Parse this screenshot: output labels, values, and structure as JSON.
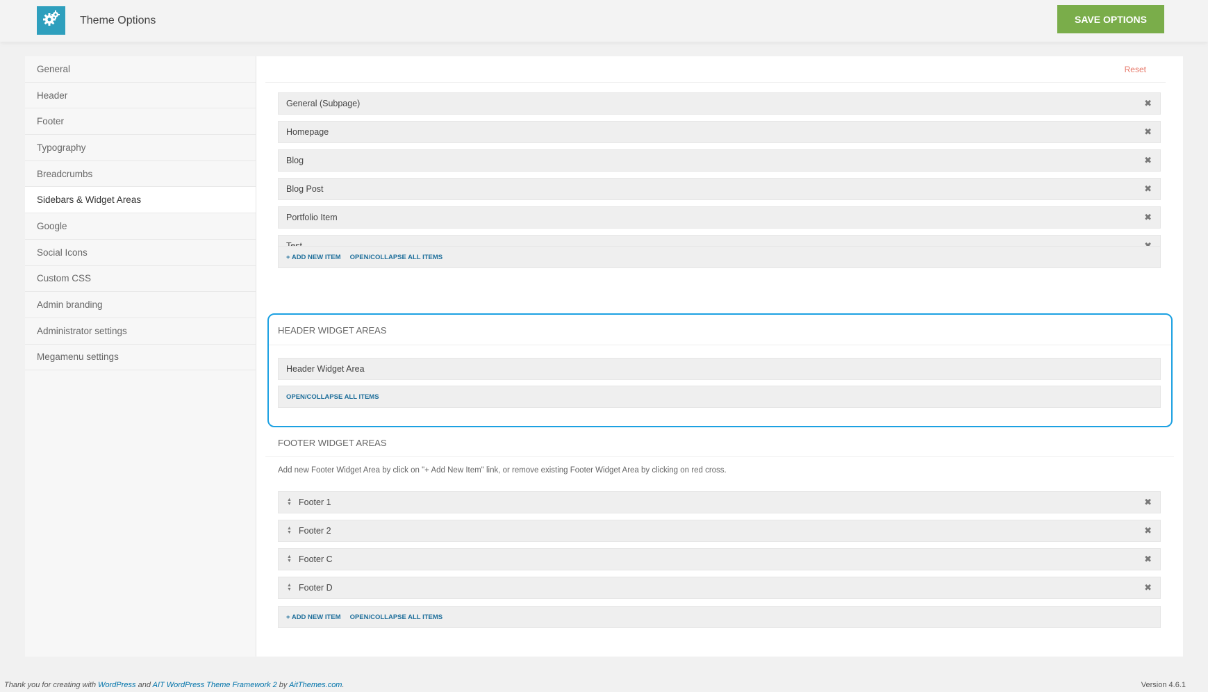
{
  "header": {
    "title": "Theme Options",
    "logo_icon": "gears-icon",
    "save_label": "SAVE OPTIONS",
    "accent": "#2e9fbd",
    "save_color": "#7aad4a"
  },
  "sidebar": {
    "items": [
      {
        "label": "General"
      },
      {
        "label": "Header"
      },
      {
        "label": "Footer"
      },
      {
        "label": "Typography"
      },
      {
        "label": "Breadcrumbs"
      },
      {
        "label": "Sidebars & Widget Areas",
        "active": true
      },
      {
        "label": "Google"
      },
      {
        "label": "Social Icons"
      },
      {
        "label": "Custom CSS"
      },
      {
        "label": "Admin branding"
      },
      {
        "label": "Administrator settings"
      },
      {
        "label": "Megamenu settings"
      }
    ]
  },
  "main": {
    "reset_label": "Reset",
    "sidebars": {
      "items": [
        "General (Subpage)",
        "Homepage",
        "Blog",
        "Blog Post",
        "Portfolio Item",
        "Test"
      ],
      "add_label": "+ ADD NEW ITEM",
      "toggle_label": "OPEN/COLLAPSE ALL ITEMS"
    },
    "header_widgets": {
      "title": "HEADER WIDGET AREAS",
      "items": [
        "Header Widget Area"
      ],
      "toggle_label": "OPEN/COLLAPSE ALL ITEMS"
    },
    "footer_widgets": {
      "title": "FOOTER WIDGET AREAS",
      "description": "Add new Footer Widget Area by click on \"+ Add New Item\" link, or remove existing Footer Widget Area by clicking on red cross.",
      "items": [
        "Footer 1",
        "Footer 2",
        "Footer C",
        "Footer D"
      ],
      "add_label": "+ ADD NEW ITEM",
      "toggle_label": "OPEN/COLLAPSE ALL ITEMS"
    }
  },
  "footer": {
    "thanks": "Thank you for creating with",
    "wordpress": "WordPress",
    "and": "and",
    "framework": "AIT WordPress Theme Framework 2",
    "by": "by",
    "company": "AitThemes.com",
    "period": ".",
    "version": "Version 4.6.1"
  }
}
